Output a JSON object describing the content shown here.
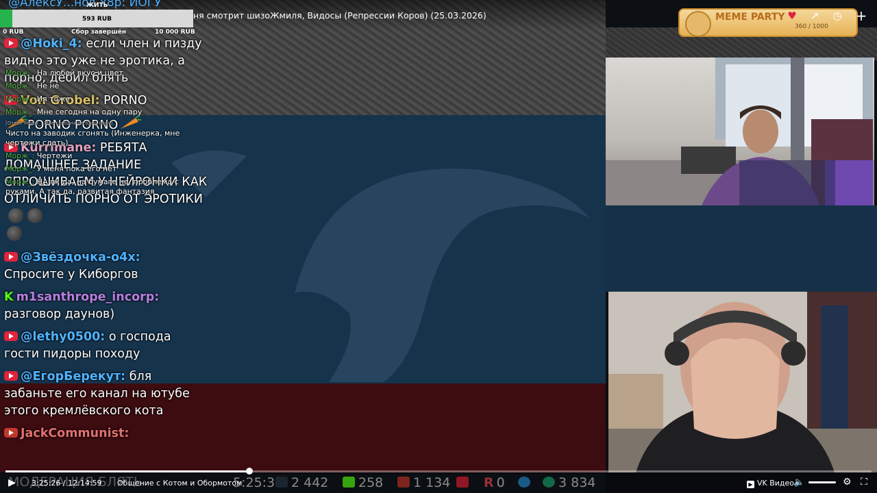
{
  "video": {
    "title": "ня смотрит шизоЖмиля, Видосы (Репрессии Коров) (25.03.2026)",
    "current_time": "3:25:26",
    "separator": "/",
    "duration": "12:14:59",
    "chapter": "Общение с Котом и Обормотом",
    "progress_fraction": 0.282,
    "brand": "VK Видео"
  },
  "donation": {
    "label_top": "ЖИТЬ",
    "amount": "593 RUB",
    "min": "0 RUB",
    "status": "Сбор завершён",
    "max": "10 000 RUB"
  },
  "top_partial": "@АлексУ...нов-x8p: ЙОГУ",
  "chat": [
    {
      "platform": "youtube",
      "user": "@Hoki_4:",
      "text": "если член и пизду видно это уже не эротика, а порно, дебил блять",
      "color": "#4fb3ff"
    },
    {
      "platform": "youtube",
      "user": "Von Grobel:",
      "text": "PORNO",
      "color": "#d9c06a"
    },
    {
      "platform": "none",
      "user": "",
      "text": "PORNO  PORNO",
      "color": "#ffffff"
    },
    {
      "platform": "youtube",
      "user": "Kurrimane:",
      "text": "РЕБЯТА ДОМАШНЕЕ ЗАДАНИЕ СПРОШИВАЕМ У НЕЙРОНКИ КАК ОТЛИЧИТЬ ПОРНО ОТ ЭРОТИКИ",
      "color": "#e0a0c0"
    },
    {
      "platform": "youtube",
      "user": "@Звёздочка-о4х:",
      "text": "Спросите у Киборгов",
      "color": "#4fb3ff"
    },
    {
      "platform": "kick",
      "user": "m1santhrope_incorp:",
      "text": "разговор даунов)",
      "color": "#b57fe0"
    },
    {
      "platform": "youtube",
      "user": "@lethy0500:",
      "text": "о господа гости пидоры походу",
      "color": "#4fb3ff"
    },
    {
      "platform": "youtube",
      "user": "@ЕгорБерекут:",
      "text": "бля забаньте его канал на ютубе этого кремлёвского кота",
      "color": "#4fb3ff"
    },
    {
      "platform": "vk",
      "user": "JackCommunist:",
      "text": "",
      "color": "#e07070"
    }
  ],
  "small_chat": [
    {
      "user": "Морж_:",
      "text": "На любой вкус и цвет"
    },
    {
      "user": "Морж_:",
      "text": "Не не"
    },
    {
      "user": "Морж_:",
      "text": "Ия тоже"
    },
    {
      "user": "Морж_:",
      "text": "Мне сегодня на одну пару"
    },
    {
      "user": "",
      "text": "[Ответ Морж_: Мне сегодня на одну пару]",
      "reply": true
    },
    {
      "user": "",
      "text": "Чисто на заводик сгонять (Инженерка, мне чертежи сдать)"
    },
    {
      "user": "Морж_:",
      "text": "Чертежи"
    },
    {
      "user": "Морж_:",
      "text": "У меня пока его нет"
    },
    {
      "user": "Морж_:",
      "text": "НА пк да, на бумаге не, проблема с руками. А так да, развитая фантазия"
    }
  ],
  "bottom_line_partial": "МОДЕРАЦИЯ БЛЯТЬ",
  "stats": {
    "clock": "5:25:30",
    "viewers_1": "2 442",
    "kick": "258",
    "vk": "1 134",
    "rutube": "0",
    "trovo": "3 834"
  },
  "meme": {
    "label": "MEME PARTY",
    "counter": "360 / 1000"
  },
  "colors": {
    "accent": "#27b34b",
    "red": "#e0243b",
    "kick": "#53fc18"
  },
  "icons": [
    "heart-icon",
    "share-icon",
    "clock-icon",
    "add-icon",
    "play-icon",
    "volume-icon",
    "settings-icon",
    "fullscreen-icon"
  ]
}
